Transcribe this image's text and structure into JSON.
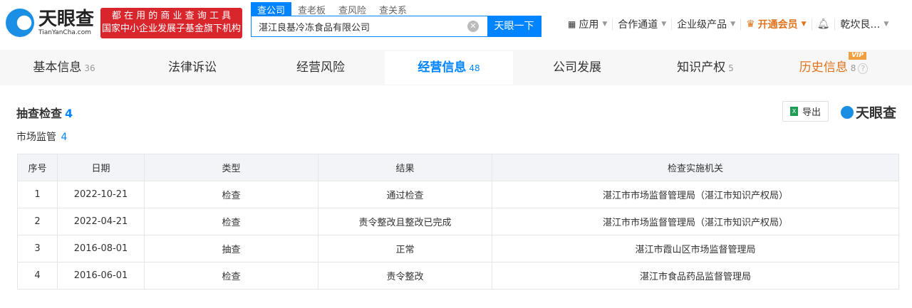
{
  "header": {
    "logo_cn": "天眼查",
    "logo_en": "TianYanCha.com",
    "slogan_1": "都 在 用 的 商 业 查 询 工 具",
    "slogan_2": "国家中小企业发展子基金旗下机构",
    "search_tabs": [
      "查公司",
      "查老板",
      "查风险",
      "查关系"
    ],
    "search_value": "湛江良基冷冻食品有限公司",
    "search_button": "天眼一下",
    "nav": {
      "apps": "应用",
      "partner": "合作通道",
      "enterprise": "企业级产品",
      "vip": "开通会员",
      "user": "乾坎艮…"
    }
  },
  "tabs": [
    {
      "label": "基本信息",
      "count": "36"
    },
    {
      "label": "法律诉讼",
      "count": ""
    },
    {
      "label": "经营风险",
      "count": ""
    },
    {
      "label": "经营信息",
      "count": "48"
    },
    {
      "label": "公司发展",
      "count": ""
    },
    {
      "label": "知识产权",
      "count": "5"
    },
    {
      "label": "历史信息",
      "count": "8",
      "badge": "VIP"
    }
  ],
  "section": {
    "title": "抽查检查",
    "count": "4",
    "sub": "市场监管",
    "sub_count": "4",
    "export": "导出",
    "brand": "天眼查"
  },
  "table": {
    "headers": [
      "序号",
      "日期",
      "类型",
      "结果",
      "检查实施机关"
    ],
    "rows": [
      [
        "1",
        "2022-10-21",
        "检查",
        "通过检查",
        "湛江市市场监督管理局（湛江市知识产权局）"
      ],
      [
        "2",
        "2022-04-21",
        "检查",
        "责令整改且整改已完成",
        "湛江市市场监督管理局（湛江市知识产权局）"
      ],
      [
        "3",
        "2016-08-01",
        "抽查",
        "正常",
        "湛江市霞山区市场监督管理局"
      ],
      [
        "4",
        "2016-06-01",
        "检查",
        "责令整改",
        "湛江市食品药品监督管理局"
      ]
    ]
  }
}
